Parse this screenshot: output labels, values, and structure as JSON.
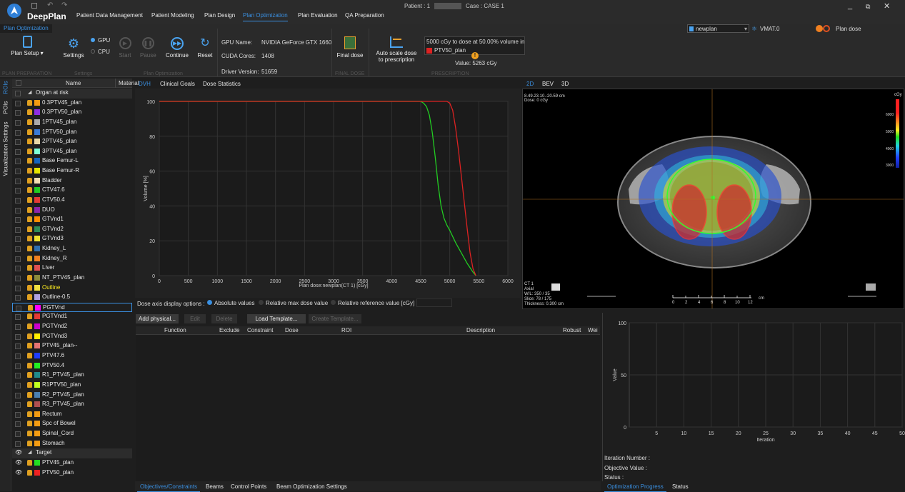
{
  "app": {
    "name": "DeepPlan",
    "patient_label": "Patient : 1",
    "case_label": "Case : CASE 1"
  },
  "menu": [
    "Patient Data Management",
    "Patient Modeling",
    "Plan Design",
    "Plan Optimization",
    "Plan Evaluation",
    "QA Preparation"
  ],
  "ribbon": {
    "tab": "Plan Optimization",
    "plan_setup": "Plan Setup",
    "settings": "Settings",
    "gpu": "GPU",
    "cpu": "CPU",
    "start": "Start",
    "pause": "Pause",
    "continue": "Continue",
    "reset": "Reset",
    "gpu_name_label": "GPU Name:",
    "gpu_name": "NVIDIA GeForce GTX 1660",
    "cuda_label": "CUDA Cores:",
    "cuda": "1408",
    "driver_label": "Driver Version:",
    "driver": "51659",
    "final_dose": "Final dose",
    "auto_scale_1": "Auto scale dose",
    "auto_scale_2": "to prescription",
    "prescription": "5000 cGy to dose at 50.00% volume in",
    "rx_roi": "PTV50_plan",
    "rx_value": "Value: 5263 cGy",
    "groups": {
      "prep": "PLAN PREPARATION",
      "settings": "Settings",
      "opt": "Plan Optimization",
      "final": "FINAL DOSE",
      "rx": "PRESCRIPTION"
    },
    "plan_select": "newplan",
    "beam_set": "VMAT.0",
    "plan_dose": "Plan dose"
  },
  "sidebar_tabs": [
    "ROIs",
    "POIs",
    "Visualization Settings"
  ],
  "roi_table": {
    "headers": [
      "Name",
      "Material"
    ]
  },
  "tree": [
    {
      "name": "Organ at risk",
      "group": true
    },
    {
      "name": "0.3PTV45_plan",
      "color": "#f39c12"
    },
    {
      "name": "0.3PTV50_plan",
      "color": "#8e2de2"
    },
    {
      "name": "1PTV45_plan",
      "color": "#aaaaaa"
    },
    {
      "name": "1PTV50_plan",
      "color": "#3a7bd5"
    },
    {
      "name": "2PTV45_plan",
      "color": "#e9d8a6"
    },
    {
      "name": "3PTV45_plan",
      "color": "#7fffd4"
    },
    {
      "name": "Base Femur-L",
      "color": "#1565c0"
    },
    {
      "name": "Base Femur-R",
      "color": "#e6e600"
    },
    {
      "name": "Bladder",
      "color": "#f5deb3"
    },
    {
      "name": "CTV47.6",
      "color": "#22cc22"
    },
    {
      "name": "CTV50.4",
      "color": "#e53935"
    },
    {
      "name": "DUO",
      "color": "#8e24aa"
    },
    {
      "name": "GTVnd1",
      "color": "#ff8c00"
    },
    {
      "name": "GTVnd2",
      "color": "#2e8b57"
    },
    {
      "name": "GTVnd3",
      "color": "#f0e130"
    },
    {
      "name": "Kidney_L",
      "color": "#2f6fb0"
    },
    {
      "name": "Kidney_R",
      "color": "#f08020"
    },
    {
      "name": "Liver",
      "color": "#e05050"
    },
    {
      "name": "NT_PTV45_plan",
      "color": "#8b8b3a"
    },
    {
      "name": "Outline",
      "color": "#f0e040",
      "hl": true
    },
    {
      "name": "Outline-0.5",
      "color": "#b0a0e0"
    },
    {
      "name": "PGTVnd",
      "color": "#ff00ff",
      "sel": true
    },
    {
      "name": "PGTVnd1",
      "color": "#e53935"
    },
    {
      "name": "PGTVnd2",
      "color": "#cc00cc"
    },
    {
      "name": "PGTVnd3",
      "color": "#ffee00"
    },
    {
      "name": "PTV45_plan--",
      "color": "#e57373"
    },
    {
      "name": "PTV47.6",
      "color": "#1e3cff"
    },
    {
      "name": "PTV50.4",
      "color": "#22ee22"
    },
    {
      "name": "R1_PTV45_plan",
      "color": "#1f8a8a"
    },
    {
      "name": "R1PTV50_plan",
      "color": "#c0ff20"
    },
    {
      "name": "R2_PTV45_plan",
      "color": "#4a7fb0"
    },
    {
      "name": "R3_PTV45_plan",
      "color": "#b05050"
    },
    {
      "name": "Rectum",
      "color": "#f39c12"
    },
    {
      "name": "Spc of Bowel",
      "color": "#f39c12"
    },
    {
      "name": "Spinal_Cord",
      "color": "#f39c12"
    },
    {
      "name": "Stomach",
      "color": "#f39c12"
    },
    {
      "name": "Target",
      "group": true,
      "eye": true
    },
    {
      "name": "PTV45_plan",
      "color": "#22dd22",
      "eye": true
    },
    {
      "name": "PTV50_plan",
      "color": "#ee2222",
      "eye": true
    }
  ],
  "center_tabs": [
    "DVH",
    "Clinical Goals",
    "Dose Statistics"
  ],
  "chart_data": {
    "type": "line",
    "xlabel": "Plan dose:newplan(CT 1) [cGy]",
    "ylabel": "Volume [%]",
    "xlim": [
      0,
      6000
    ],
    "ylim": [
      0,
      100
    ],
    "xticks": [
      0,
      500,
      1000,
      1500,
      2000,
      2500,
      3000,
      3500,
      4000,
      4500,
      5000,
      5500,
      6000
    ],
    "yticks": [
      0,
      20,
      40,
      60,
      80,
      100
    ],
    "grid": true,
    "series": [
      {
        "color": "#22cc22",
        "x": [
          0,
          4500,
          4550,
          4600,
          4650,
          4700,
          4750,
          4800,
          4850,
          4900,
          4950,
          5000,
          5100,
          5200,
          5300,
          5400,
          5450
        ],
        "y": [
          100,
          100,
          99,
          97,
          92,
          82,
          68,
          52,
          40,
          33,
          29,
          26,
          19,
          13,
          7,
          2,
          0
        ]
      },
      {
        "color": "#dd2222",
        "x": [
          0,
          4950,
          5000,
          5050,
          5100,
          5150,
          5200,
          5250,
          5300,
          5350,
          5400,
          5450
        ],
        "y": [
          100,
          100,
          99,
          95,
          85,
          72,
          57,
          42,
          27,
          13,
          4,
          0
        ]
      }
    ]
  },
  "dose_axis": {
    "label": "Dose axis display options :",
    "options": [
      "Absolute values",
      "Relative max dose value",
      "Relative reference value [cGy]"
    ],
    "selected": 0
  },
  "view_tabs": [
    "2D",
    "BEV",
    "3D"
  ],
  "ct": {
    "info1": "8.49.23.10.-20.59  cm",
    "info2": "Dose: 0 cGy",
    "bottom": [
      "CT 1",
      "Axial",
      "W/L: 350 / 35",
      "Slice: 78 / 175",
      "Thickness: 0.300 cm"
    ],
    "scale_ticks": [
      "0",
      "2",
      "4",
      "6",
      "8",
      "10",
      "12"
    ],
    "scale_unit": "cm",
    "colorbar": {
      "unit": "cGy",
      "ticks": [
        "6000",
        "5000",
        "4000",
        "3000"
      ]
    }
  },
  "objectives": {
    "buttons": [
      "Add physical...",
      "Edit",
      "Delete",
      "Load Template...",
      "Create Template..."
    ],
    "headers": [
      "Function",
      "Exclude",
      "Constraint",
      "Dose",
      "ROI",
      "Description",
      "Robust",
      "Wei"
    ]
  },
  "bottom_tabs": [
    "Objectives/Constraints",
    "Beams",
    "Control Points",
    "Beam Optimization Settings"
  ],
  "progress": {
    "chart_data": {
      "type": "line",
      "xlabel": "Iteration",
      "ylabel": "Value",
      "xlim": [
        0,
        50
      ],
      "ylim": [
        0,
        100
      ],
      "xticks": [
        5,
        10,
        15,
        20,
        25,
        30,
        35,
        40,
        45,
        50
      ],
      "yticks": [
        0,
        50,
        100
      ],
      "series": []
    },
    "iteration_label": "Iteration Number :",
    "objective_label": "Objective Value :",
    "status_label": "Status :",
    "tabs": [
      "Optimization Progress",
      "Status"
    ]
  }
}
